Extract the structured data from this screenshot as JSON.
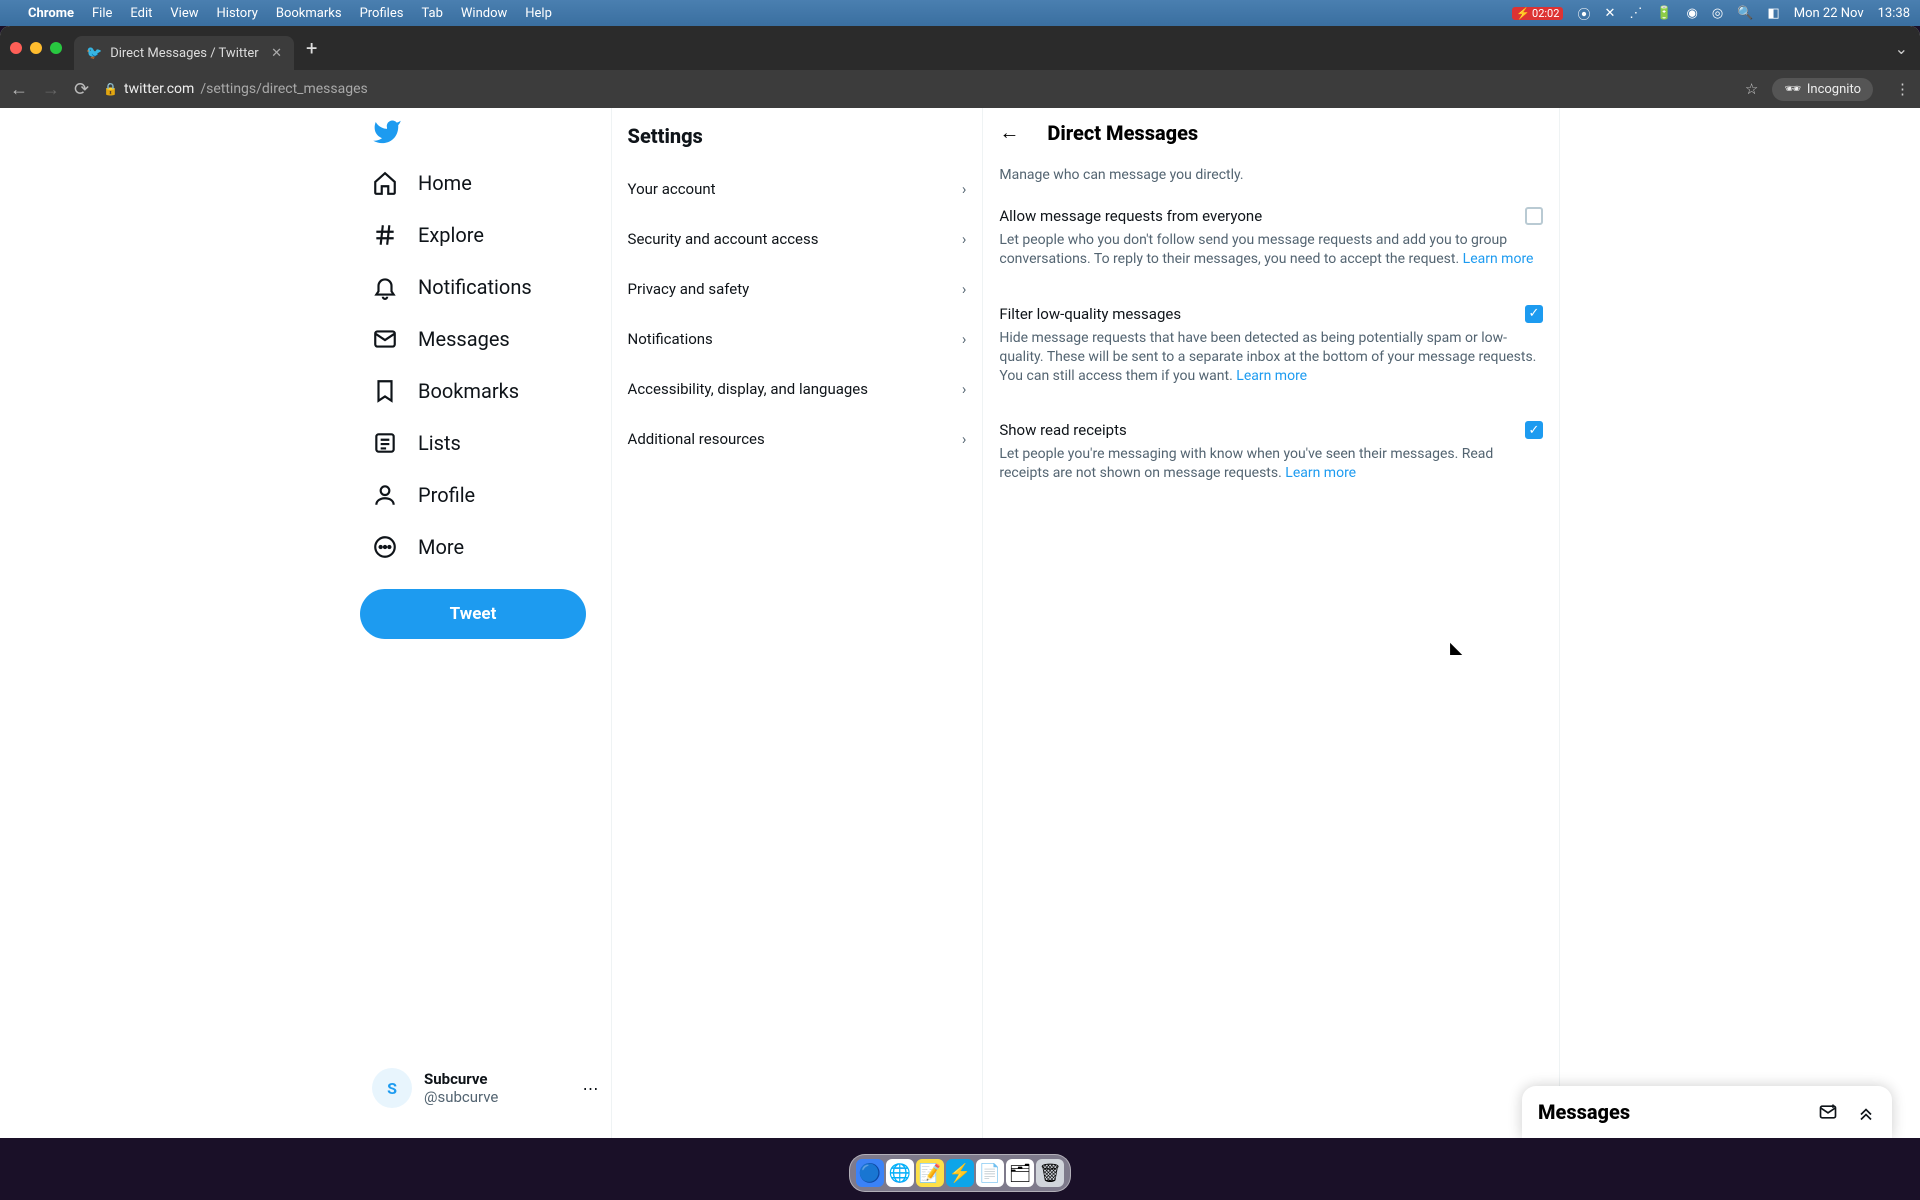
{
  "menubar": {
    "app": "Chrome",
    "items": [
      "File",
      "Edit",
      "View",
      "History",
      "Bookmarks",
      "Profiles",
      "Tab",
      "Window",
      "Help"
    ],
    "battery_time": "02:02",
    "date": "Mon 22 Nov",
    "time": "13:38"
  },
  "chrome": {
    "tab_title": "Direct Messages / Twitter",
    "url_host": "twitter.com",
    "url_path": "/settings/direct_messages",
    "incognito_label": "Incognito"
  },
  "nav": {
    "items": [
      {
        "icon": "home-icon",
        "label": "Home"
      },
      {
        "icon": "explore-icon",
        "label": "Explore"
      },
      {
        "icon": "notifications-icon",
        "label": "Notifications"
      },
      {
        "icon": "messages-icon",
        "label": "Messages"
      },
      {
        "icon": "bookmarks-icon",
        "label": "Bookmarks"
      },
      {
        "icon": "lists-icon",
        "label": "Lists"
      },
      {
        "icon": "profile-icon",
        "label": "Profile"
      },
      {
        "icon": "more-icon",
        "label": "More"
      }
    ],
    "tweet": "Tweet"
  },
  "account": {
    "name": "Subcurve",
    "handle": "@subcurve"
  },
  "settings": {
    "heading": "Settings",
    "rows": [
      "Your account",
      "Security and account access",
      "Privacy and safety",
      "Notifications",
      "Accessibility, display, and languages",
      "Additional resources"
    ]
  },
  "detail": {
    "title": "Direct Messages",
    "subtitle": "Manage who can message you directly.",
    "options": [
      {
        "label": "Allow message requests from everyone",
        "checked": false,
        "desc": "Let people who you don't follow send you message requests and add you to group conversations. To reply to their messages, you need to accept the request. ",
        "link": "Learn more"
      },
      {
        "label": "Filter low-quality messages",
        "checked": true,
        "desc": "Hide message requests that have been detected as being potentially spam or low-quality. These will be sent to a separate inbox at the bottom of your message requests. You can still access them if you want. ",
        "link": "Learn more"
      },
      {
        "label": "Show read receipts",
        "checked": true,
        "desc": "Let people you're messaging with know when you've seen their messages. Read receipts are not shown on message requests. ",
        "link": "Learn more"
      }
    ]
  },
  "drawer": {
    "title": "Messages"
  }
}
